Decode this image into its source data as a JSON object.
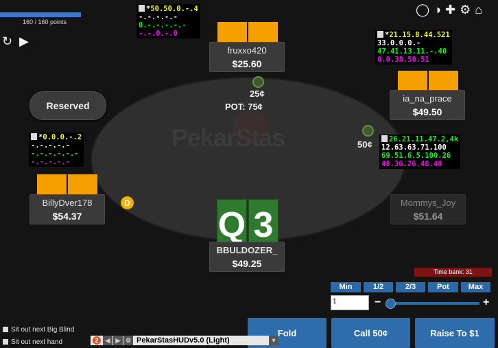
{
  "points": {
    "label": "160 / 160 points",
    "fraction": 1.0
  },
  "top_icons": [
    "chat-icon",
    "stats-icon",
    "add-icon",
    "gear-icon",
    "home-icon"
  ],
  "reserved_label": "Reserved",
  "watermark": "PekarStas",
  "pot": {
    "bet": "25¢",
    "label": "POT: 75¢"
  },
  "players": {
    "fruxxo": {
      "name": "fruxxo420",
      "stack": "$25.60"
    },
    "ia": {
      "name": "ia_na_prace",
      "stack": "$49.50",
      "bet": "50¢"
    },
    "billy": {
      "name": "BillyDver178",
      "stack": "$54.37"
    },
    "mommy": {
      "name": "Mommys_Joy",
      "stack": "$51.64"
    },
    "hero": {
      "name": "BBULDOZER_",
      "stack": "$49.25",
      "cards": [
        "Q",
        "3"
      ]
    }
  },
  "hud": {
    "fruxxo": [
      [
        [
          "*",
          "#ffffff"
        ],
        [
          "50.50.0.-.4",
          "#ffff00"
        ]
      ],
      [
        [
          "-.-.-.-.-",
          "#ffffff"
        ]
      ],
      [
        [
          "0.-.-.-.-.-",
          "#00ff00"
        ]
      ],
      [
        [
          "-.-.0.-.0",
          "#ff00ff"
        ]
      ]
    ],
    "ia": [
      [
        [
          "*",
          "#ffffff"
        ],
        [
          "21.15.8.44.521",
          "#ffff00"
        ]
      ],
      [
        [
          "33.0.0.0.-",
          "#ffffff"
        ]
      ],
      [
        [
          "47.41.13.11.-.40",
          "#00ff00"
        ]
      ],
      [
        [
          "0.0.38.50.51",
          "#ff00ff"
        ]
      ]
    ],
    "billy": [
      [
        [
          "*",
          "#ffffff"
        ],
        [
          "0.0.0.-.2",
          "#ffff00"
        ]
      ],
      [
        [
          "-.-.-.-.-",
          "#ffffff"
        ]
      ],
      [
        [
          "-.-.-.-.-.-",
          "#00ff00"
        ]
      ],
      [
        [
          "-.-.-.-.-",
          "#ff00ff"
        ]
      ]
    ],
    "mommy": [
      [
        [
          "26.21.11.47.2,4k",
          "#00ff00"
        ]
      ],
      [
        [
          "12.63.63.71.100",
          "#ffffff"
        ]
      ],
      [
        [
          "69.51.6.5.100.26",
          "#00ff00"
        ]
      ],
      [
        [
          "48.36.26.48.48",
          "#ff00ff"
        ]
      ]
    ]
  },
  "dealer_label": "D",
  "time_bank": "Time bank: 31",
  "bet_sizes": [
    "Min",
    "1/2",
    "2/3",
    "Pot",
    "Max"
  ],
  "bet_amount": "1",
  "slider_minus": "−",
  "slider_plus": "+",
  "actions": {
    "fold": "Fold",
    "call": "Call 50¢",
    "raise": "Raise To $1"
  },
  "sitout": {
    "big_blind": "Sit out next Big Blind",
    "hand": "Sit out next hand"
  },
  "hudbar": {
    "badge": "2",
    "title": "PekarStasHUDv5.0 (Light)"
  },
  "colors": {
    "stack_orange": "#f5a000",
    "button_blue": "#2e6cab",
    "felt": "#2f2f2f",
    "hero_card": "#2e7a2e",
    "time_bank": "#7c1414"
  }
}
